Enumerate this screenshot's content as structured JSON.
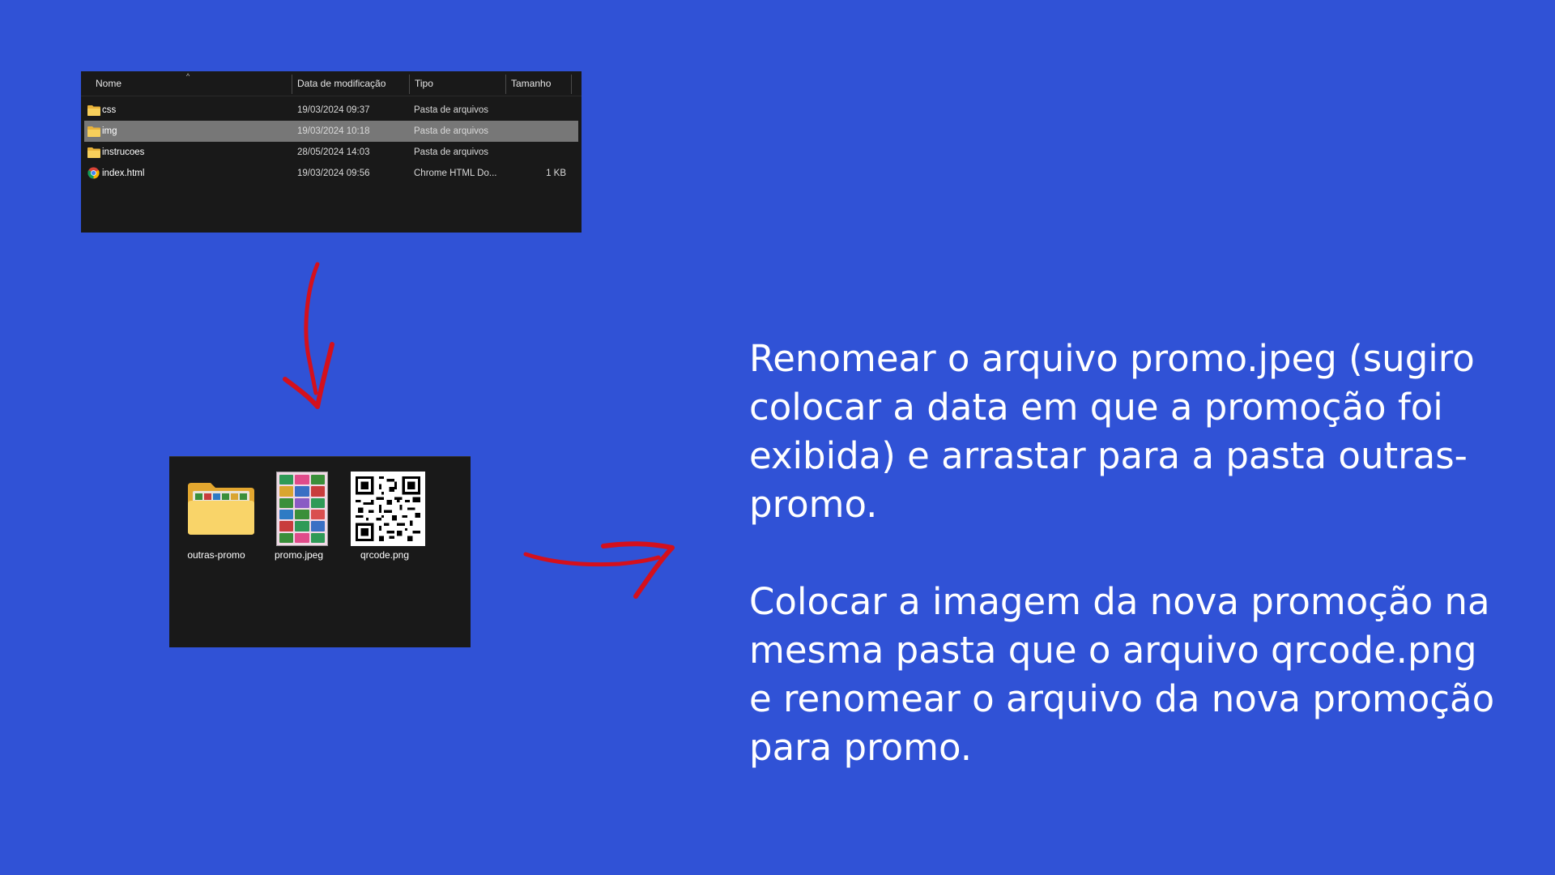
{
  "details_view": {
    "columns": [
      {
        "label": "Nome"
      },
      {
        "label": "Data de modificação"
      },
      {
        "label": "Tipo"
      },
      {
        "label": "Tamanho"
      }
    ],
    "rows": [
      {
        "name": "css",
        "date": "19/03/2024 09:37",
        "type": "Pasta de arquivos",
        "size": "",
        "icon": "folder-icon",
        "selected": false
      },
      {
        "name": "img",
        "date": "19/03/2024 10:18",
        "type": "Pasta de arquivos",
        "size": "",
        "icon": "folder-icon",
        "selected": true
      },
      {
        "name": "instrucoes",
        "date": "28/05/2024 14:03",
        "type": "Pasta de arquivos",
        "size": "",
        "icon": "folder-icon",
        "selected": false
      },
      {
        "name": "index.html",
        "date": "19/03/2024 09:56",
        "type": "Chrome HTML Do...",
        "size": "1 KB",
        "icon": "chrome-icon",
        "selected": false
      }
    ]
  },
  "icon_view": {
    "items": [
      {
        "label": "outras-promo",
        "icon": "folder-icon"
      },
      {
        "label": "promo.jpeg",
        "icon": "image-thumbnail"
      },
      {
        "label": "qrcode.png",
        "icon": "qr-code-thumbnail"
      }
    ]
  },
  "instructions": {
    "paragraph1": "Renomear o arquivo promo.jpeg (sugiro colocar a data em que a promoção foi exibida) e arrastar para a pasta outras-promo.",
    "paragraph2": "Colocar a imagem da nova promoção na mesma pasta que o arquivo qrcode.png e renomear o arquivo da nova promoção para promo."
  },
  "colors": {
    "background": "#3052d6",
    "explorer_bg": "#191919",
    "selection": "#777777",
    "arrow": "#d4101c",
    "folder": "#f5c542"
  }
}
